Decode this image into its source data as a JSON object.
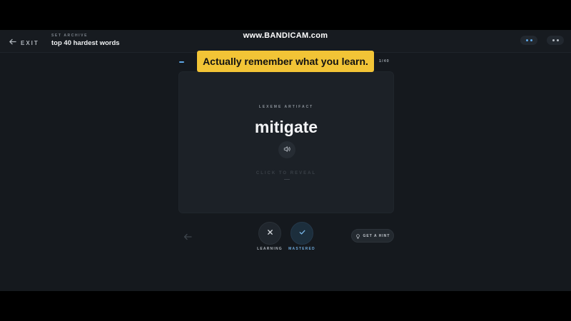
{
  "header": {
    "exit_label": "EXIT",
    "breadcrumb_small": "SET ARCHIVE",
    "set_title": "top 40 hardest words",
    "watermark": "www.BANDICAM.com"
  },
  "progress": {
    "counter": "1/40",
    "fraction": 0.025
  },
  "banner": {
    "text": "Actually remember what you learn."
  },
  "card": {
    "eyebrow": "LEXEME ARTIFACT",
    "word": "mitigate",
    "reveal": "CLICK TO REVEAL"
  },
  "controls": {
    "learning_label": "LEARNING",
    "mastered_label": "MASTERED",
    "hint_label": "GET A HINT"
  },
  "icons": {
    "exit": "arrow-left-icon",
    "audio": "speaker-icon",
    "back": "arrow-left-icon",
    "learning": "close-icon",
    "mastered": "check-icon",
    "hint": "lightbulb-icon"
  },
  "colors": {
    "accent": "#5ea8e8",
    "banner": "#f2c436",
    "background": "#15191e",
    "card": "#1c2127"
  }
}
